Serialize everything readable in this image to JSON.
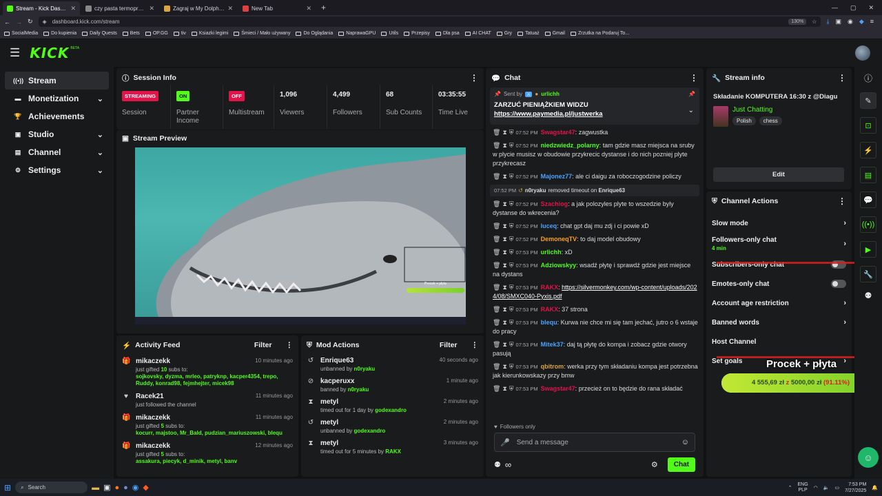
{
  "browser": {
    "tabs": [
      {
        "title": "Stream - Kick Dashboard",
        "color": "#53fc18",
        "active": true
      },
      {
        "title": "czy pasta termoprzewodzaca j",
        "color": "#888888",
        "active": false
      },
      {
        "title": "Zagraj w My Dolphin Show",
        "color": "#d9a441",
        "active": false
      },
      {
        "title": "New Tab",
        "color": "#e04040",
        "active": false
      }
    ],
    "url": "dashboard.kick.com/stream",
    "zoom": "130%",
    "bookmarks": [
      "SocialMedia",
      "Do kupienia",
      "Daily Quests",
      "Bets",
      "OP.GG",
      "tiv",
      "Ksiazki legimi",
      "Śmieci / Mało używany",
      "Do Oglądania",
      "NaprawaGPU",
      "Utils",
      "Przepisy",
      "Dla psa",
      "AI CHAT",
      "Gry",
      "Tatuaż",
      "Gmail",
      "Zrzutka na Podaruj To..."
    ]
  },
  "app": {
    "logo": "KICK",
    "logo_tag": "BETA"
  },
  "sidebar": {
    "items": [
      {
        "label": "Stream",
        "icon": "broadcast-icon",
        "glyph": "((•))",
        "active": true,
        "chevron": false
      },
      {
        "label": "Monetization",
        "icon": "wallet-icon",
        "glyph": "▬",
        "active": false,
        "chevron": true
      },
      {
        "label": "Achievements",
        "icon": "trophy-icon",
        "glyph": "🏆",
        "active": false,
        "chevron": false
      },
      {
        "label": "Studio",
        "icon": "studio-icon",
        "glyph": "▣",
        "active": false,
        "chevron": true
      },
      {
        "label": "Channel",
        "icon": "channel-icon",
        "glyph": "▤",
        "active": false,
        "chevron": true
      },
      {
        "label": "Settings",
        "icon": "gear-icon",
        "glyph": "⚙",
        "active": false,
        "chevron": true
      }
    ]
  },
  "session": {
    "title": "Session Info",
    "stats": [
      {
        "value": "STREAMING",
        "label": "Session",
        "badge": "#e2144a"
      },
      {
        "value": "ON",
        "label": "Partner Income",
        "badge": "#53fc18"
      },
      {
        "value": "OFF",
        "label": "Multistream",
        "badge": "#e2144a"
      },
      {
        "value": "1,096",
        "label": "Viewers"
      },
      {
        "value": "4,499",
        "label": "Followers"
      },
      {
        "value": "68",
        "label": "Sub Counts"
      },
      {
        "value": "03:35:55",
        "label": "Time Live"
      }
    ]
  },
  "preview": {
    "title": "Stream Preview",
    "overlay_title": "Procek + płyta"
  },
  "activity": {
    "title": "Activity Feed",
    "filter": "Filter",
    "items": [
      {
        "icon": "gift-icon",
        "glyph": "🎁",
        "name": "mikaczekk",
        "time": "10 minutes ago",
        "text_pre": "just gifted ",
        "count": "10",
        "text_post": " subs to:",
        "names": "sojkovsky, dyzma, mrleo, patryknp, kacper4354, trepo, Ruddy, konrad98, fejmhejter, micek98"
      },
      {
        "icon": "heart-icon",
        "glyph": "♥",
        "name": "Racek21",
        "time": "11 minutes ago",
        "text_pre": "just followed the channel",
        "count": "",
        "text_post": "",
        "names": ""
      },
      {
        "icon": "gift-icon",
        "glyph": "🎁",
        "name": "mikaczekk",
        "time": "11 minutes ago",
        "text_pre": "just gifted ",
        "count": "5",
        "text_post": " subs to:",
        "names": "kocurr, majstoo, Mr_Bald, pudzian_mariuszowski, blequ"
      },
      {
        "icon": "gift-icon",
        "glyph": "🎁",
        "name": "mikaczekk",
        "time": "12 minutes ago",
        "text_pre": "just gifted ",
        "count": "5",
        "text_post": " subs to:",
        "names": "assakura, piecyk, d_minik, metyl, banv"
      }
    ]
  },
  "mod": {
    "title": "Mod Actions",
    "filter": "Filter",
    "items": [
      {
        "icon": "undo-icon",
        "glyph": "↺",
        "name": "Enrique63",
        "time": "40 seconds ago",
        "action": "unbanned by ",
        "by": "n0ryaku"
      },
      {
        "icon": "ban-icon",
        "glyph": "⊘",
        "name": "kacperuxx",
        "time": "1 minute ago",
        "action": "banned by ",
        "by": "n0ryaku"
      },
      {
        "icon": "hourglass-icon",
        "glyph": "⧗",
        "name": "metyl",
        "time": "2 minutes ago",
        "action": "timed out for 1 day by ",
        "by": "godexandro"
      },
      {
        "icon": "undo-icon",
        "glyph": "↺",
        "name": "metyl",
        "time": "2 minutes ago",
        "action": "unbanned by ",
        "by": "godexandro"
      },
      {
        "icon": "hourglass-icon",
        "glyph": "⧗",
        "name": "metyl",
        "time": "3 minutes ago",
        "action": "timed out for 5 minutes by ",
        "by": "RAKX"
      }
    ]
  },
  "chat": {
    "title": "Chat",
    "pinned": {
      "sent_by": "Sent by",
      "user": "urlichh",
      "text": "ZARZUĆ PIENIĄŻKIEM WIDZU ",
      "link": "https://www.paymedia.pl/justwerka"
    },
    "messages": [
      {
        "time": "07:52 PM",
        "user": "Swagstar47",
        "color": "#e2144a",
        "text": "zagwustka"
      },
      {
        "time": "07:52 PM",
        "user": "niedzwiedz_polarny",
        "color": "#53fc18",
        "text": "tam gdzie masz miejsca na sruby w plycie musisz w obudowie przykrecic dystanse i do nich pozniej plyte przykrecasz"
      },
      {
        "time": "07:52 PM",
        "user": "Majonez77",
        "color": "#4aa3ff",
        "text": "ale ci daigu za roboczogodzine policzy"
      },
      {
        "system": true,
        "time": "07:52 PM",
        "user": "n0ryaku",
        "text": "removed timeout on ",
        "target": "Enrique63"
      },
      {
        "time": "07:52 PM",
        "user": "Szachiog",
        "color": "#e2144a",
        "text": "a jak polozyles plyte to wszedzie byly dystanse do wkrecenia?"
      },
      {
        "time": "07:52 PM",
        "user": "luceq",
        "color": "#4aa3ff",
        "text": "chat gpt daj mu zdj i ci powie xD"
      },
      {
        "time": "07:52 PM",
        "user": "DemoneqTV",
        "color": "#ff9f1a",
        "text": "to daj model obudowy"
      },
      {
        "time": "07:53 PM",
        "user": "urlichh",
        "color": "#53fc18",
        "text": "xD"
      },
      {
        "time": "07:53 PM",
        "user": "Adziowskyy",
        "color": "#53fc18",
        "text": "wsadź płytę i sprawdź gdzie jest miejsce na dystans"
      },
      {
        "time": "07:53 PM",
        "user": "RAKX",
        "color": "#e2144a",
        "text": "",
        "link": "https://silvermonkey.com/wp-content/uploads/2024/08/SMXC040-Pyxis.pdf"
      },
      {
        "time": "07:53 PM",
        "user": "RAKX",
        "color": "#e2144a",
        "text": "37 strona"
      },
      {
        "time": "07:53 PM",
        "user": "blequ",
        "color": "#4aa3ff",
        "text": "Kurwa nie chce mi się tam jechać, jutro o 6 wstaje do pracy"
      },
      {
        "time": "07:53 PM",
        "user": "Mitek37",
        "color": "#4aa3ff",
        "text": "daj tą płytę do kompa i zobacz gdzie otwory pasują"
      },
      {
        "time": "07:53 PM",
        "user": "qbitrom",
        "color": "#d9a441",
        "text": "werka przy tym składaniu kompa jest potrzebna jak kierunkowskazy przy bmw"
      },
      {
        "time": "07:53 PM",
        "user": "Swagstar47",
        "color": "#e2144a",
        "text": "przecież on to będzie do rana składać"
      }
    ],
    "followers_only": "Followers only",
    "placeholder": "Send a message",
    "send": "Chat"
  },
  "stream_info": {
    "title": "Stream info",
    "stream_title": "Składanie KOMPUTERA 16:30 z @Diagu",
    "category": "Just Chatting",
    "tags": [
      "Polish",
      "chess"
    ],
    "edit": "Edit"
  },
  "channel_actions": {
    "title": "Channel Actions",
    "items": [
      {
        "label": "Slow mode",
        "sub": "",
        "kind": "chevron"
      },
      {
        "label": "Followers-only chat",
        "sub": "4 min",
        "kind": "chevron"
      },
      {
        "label": "Subscribers-only chat",
        "sub": "",
        "kind": "toggle"
      },
      {
        "label": "Emotes-only chat",
        "sub": "",
        "kind": "toggle"
      },
      {
        "label": "Account age restriction",
        "sub": "",
        "kind": "chevron"
      },
      {
        "label": "Banned words",
        "sub": "",
        "kind": "chevron"
      },
      {
        "label": "Host Channel",
        "sub": "",
        "kind": "none"
      },
      {
        "label": "Set goals",
        "sub": "",
        "kind": "chevron"
      }
    ]
  },
  "goal_overlay": {
    "title": "Procek + płyta",
    "current": "4 555,69 zł",
    "sep": "z",
    "target": "5000,00 zł",
    "percent_text": "(91.11%)",
    "progress": 0.9111
  },
  "taskbar": {
    "search": "Search",
    "lang": "ENG\nPLP",
    "time": "7:53 PM",
    "date": "7/27/2025"
  },
  "colors": {
    "accent": "#53fc18",
    "danger": "#e2144a",
    "panel": "#191b1d",
    "bg": "#111213"
  }
}
